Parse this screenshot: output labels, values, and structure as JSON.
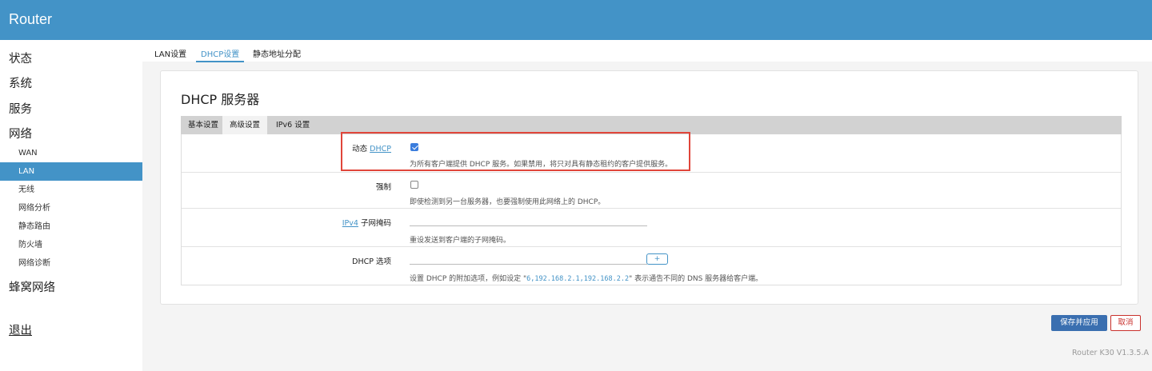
{
  "app": {
    "title": "Router"
  },
  "sidebar": {
    "main_items": [
      "状态",
      "系统",
      "服务",
      "网络"
    ],
    "sub_items": [
      "WAN",
      "LAN",
      "无线",
      "网络分析",
      "静态路由",
      "防火墙",
      "网络诊断"
    ],
    "active_sub": "LAN",
    "cellular": "蜂窝网络",
    "logout": "退出"
  },
  "top_tabs": [
    "LAN设置",
    "DHCP设置",
    "静态地址分配"
  ],
  "active_top_tab": "DHCP设置",
  "section": {
    "title": "DHCP 服务器",
    "tabs": [
      "基本设置",
      "高级设置",
      "IPv6 设置"
    ],
    "active_tab": "高级设置"
  },
  "fields": {
    "dynamic_dhcp": {
      "label_prefix": "动态",
      "label_link": "DHCP",
      "checked": true,
      "desc": "为所有客户端提供 DHCP 服务。如果禁用，将只对具有静态租约的客户提供服务。"
    },
    "force": {
      "label": "强制",
      "checked": false,
      "desc": "即使检测到另一台服务器，也要强制使用此网络上的 DHCP。"
    },
    "ipv4_netmask": {
      "label_link": "IPv4",
      "label_suffix": "子网掩码",
      "value": "",
      "desc": "重设发送到客户端的子网掩码。"
    },
    "dhcp_options": {
      "label": "DHCP 选项",
      "value": "",
      "add_label": "+",
      "desc_prefix": "设置 DHCP 的附加选项，例如设定 \"",
      "desc_code": "6,192.168.2.1,192.168.2.2",
      "desc_suffix": "\" 表示通告不同的 DNS 服务器给客户端。"
    }
  },
  "buttons": {
    "save": "保存并应用",
    "cancel": "取消"
  },
  "footer": {
    "version": "Router K30 V1.3.5.A"
  },
  "colors": {
    "header": "#4393c7",
    "active_link": "#4393c7",
    "save_button": "#3a6fb0",
    "cancel": "#c9302c",
    "highlight": "#e0453a"
  }
}
